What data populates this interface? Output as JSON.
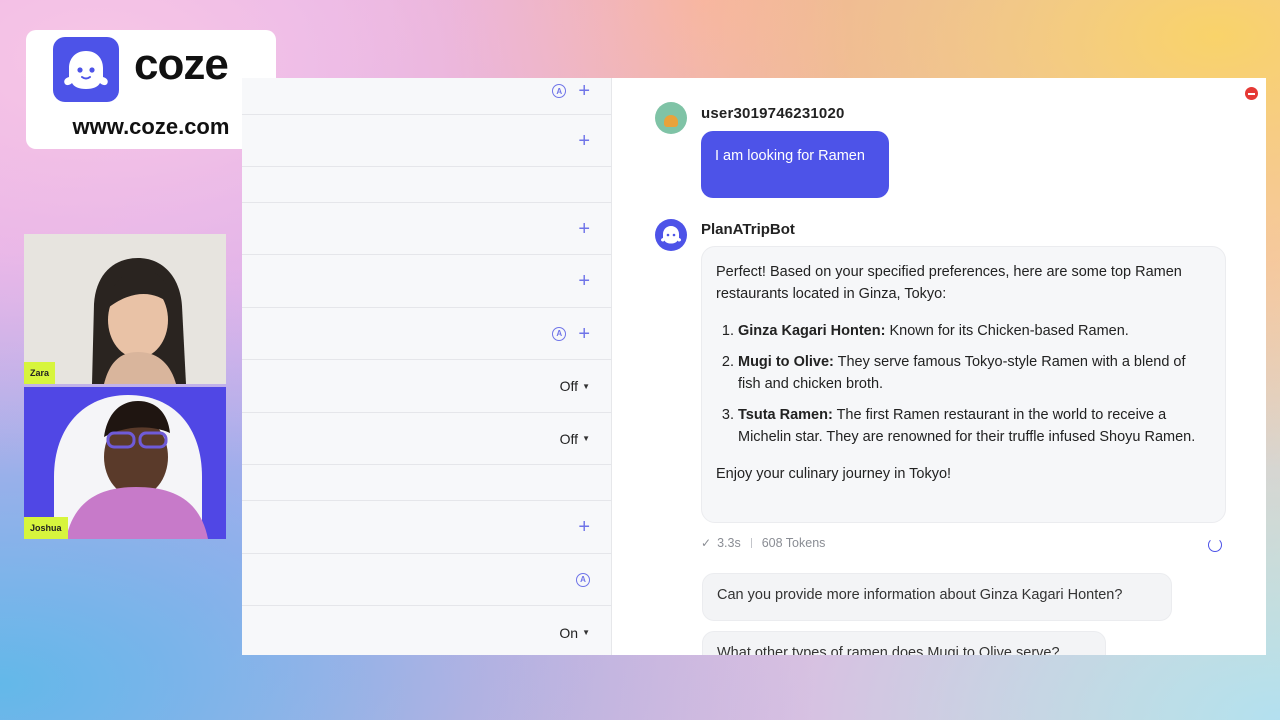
{
  "brand": {
    "name": "coze",
    "url": "www.coze.com",
    "color": "#4d53e8"
  },
  "participants": [
    {
      "name": "Zara"
    },
    {
      "name": "Joshua"
    }
  ],
  "settings_rows": [
    {
      "action": "a-plus"
    },
    {
      "action": "plus"
    },
    {
      "action": "none"
    },
    {
      "action": "plus"
    },
    {
      "action": "plus"
    },
    {
      "action": "a-plus"
    },
    {
      "action": "toggle",
      "value": "Off"
    },
    {
      "action": "toggle",
      "value": "Off"
    },
    {
      "action": "none"
    },
    {
      "action": "plus"
    },
    {
      "action": "a"
    },
    {
      "action": "toggle",
      "value": "On"
    }
  ],
  "chat": {
    "user": {
      "name": "user3019746231020",
      "message": "I am looking for Ramen"
    },
    "bot": {
      "name": "PlanATripBot",
      "intro": "Perfect! Based on your specified preferences, here are some top Ramen restaurants located in Ginza, Tokyo:",
      "items": [
        {
          "title": "Ginza Kagari Honten:",
          "text": " Known for its Chicken-based Ramen."
        },
        {
          "title": "Mugi to Olive:",
          "text": " They serve famous Tokyo-style Ramen with a blend of fish and chicken broth."
        },
        {
          "title": "Tsuta Ramen:",
          "text": " The first Ramen restaurant in the world to receive a Michelin star. They are renowned for their truffle infused Shoyu Ramen."
        }
      ],
      "closing": "Enjoy your culinary journey in Tokyo!",
      "duration": "3.3s",
      "tokens": "608 Tokens"
    },
    "suggestions": [
      "Can you provide more information about Ginza Kagari Honten?",
      "What other types of ramen does Mugi to Olive serve?"
    ]
  }
}
